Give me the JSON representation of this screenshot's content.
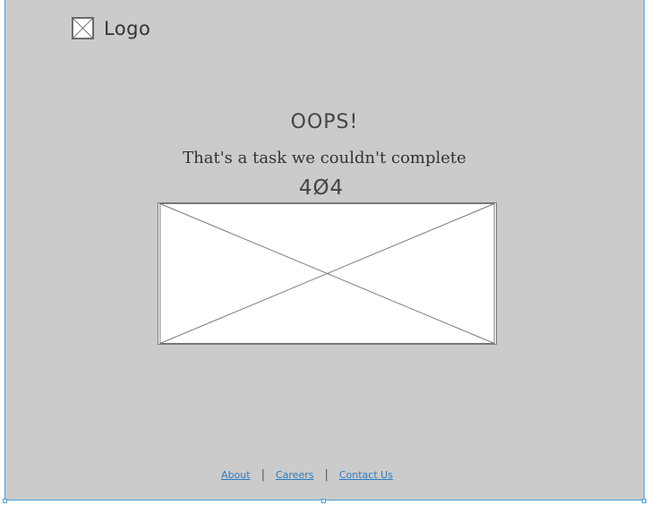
{
  "header": {
    "logo_label": "Logo",
    "logo_icon": "image-placeholder-icon"
  },
  "main": {
    "heading": "OOPS!",
    "message": "That's a task we couldn't complete",
    "error_code": "4Ø4",
    "image_icon": "image-placeholder-icon"
  },
  "footer": {
    "links": [
      "About",
      "Careers",
      "Contact Us"
    ],
    "separator": "|"
  },
  "colors": {
    "background": "#cbcbcb",
    "link": "#2b7bc0",
    "selection": "#4a9fd8"
  }
}
